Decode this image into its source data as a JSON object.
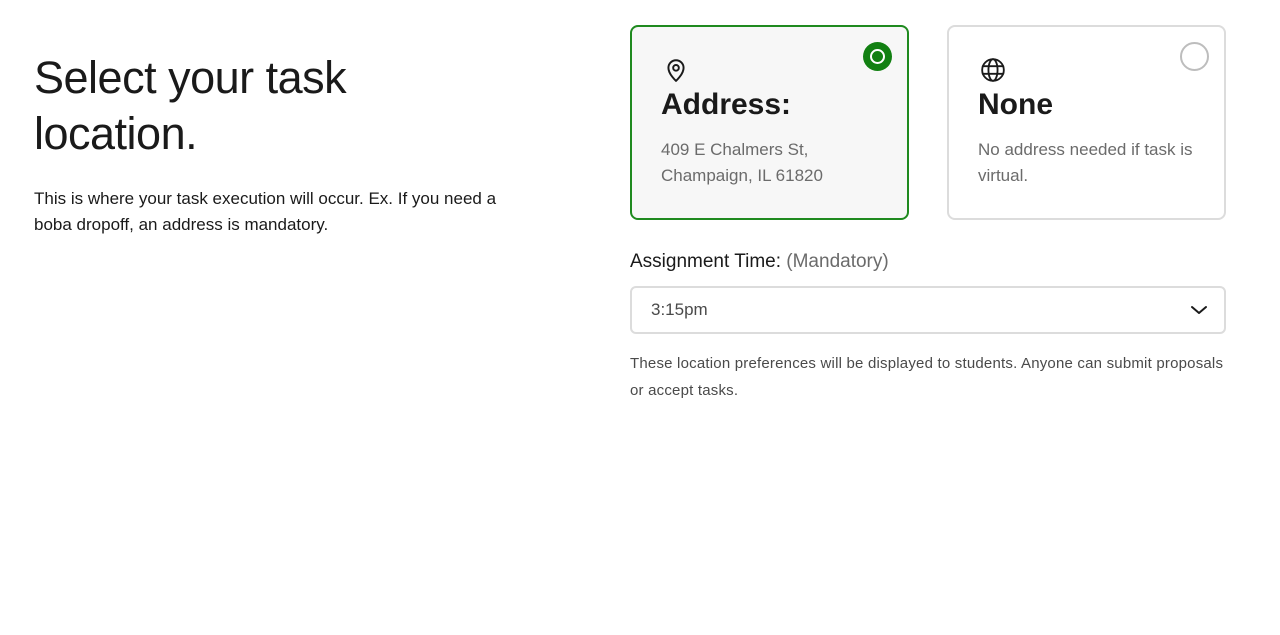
{
  "intro": {
    "title": "Select your task location.",
    "description": "This is where your task execution will occur. Ex. If you need a boba dropoff, an address is mandatory."
  },
  "options": [
    {
      "icon": "map-pin-icon",
      "title": "Address:",
      "description": "409 E Chalmers St, Champaign, IL 61820",
      "selected": true
    },
    {
      "icon": "globe-icon",
      "title": "None",
      "description": "No address needed if task is virtual.",
      "selected": false
    }
  ],
  "assignment_time": {
    "label": "Assignment Time:",
    "qualifier": "(Mandatory)",
    "selected_value": "3:15pm",
    "icon": "chevron-down-icon"
  },
  "note": "These location preferences will be displayed to students. Anyone can submit proposals or accept tasks.",
  "colors": {
    "selected_border": "#1f8a1f",
    "selected_radio": "#128012",
    "unselected_border": "#dcdcdc",
    "muted_text": "#6b6b6b"
  }
}
